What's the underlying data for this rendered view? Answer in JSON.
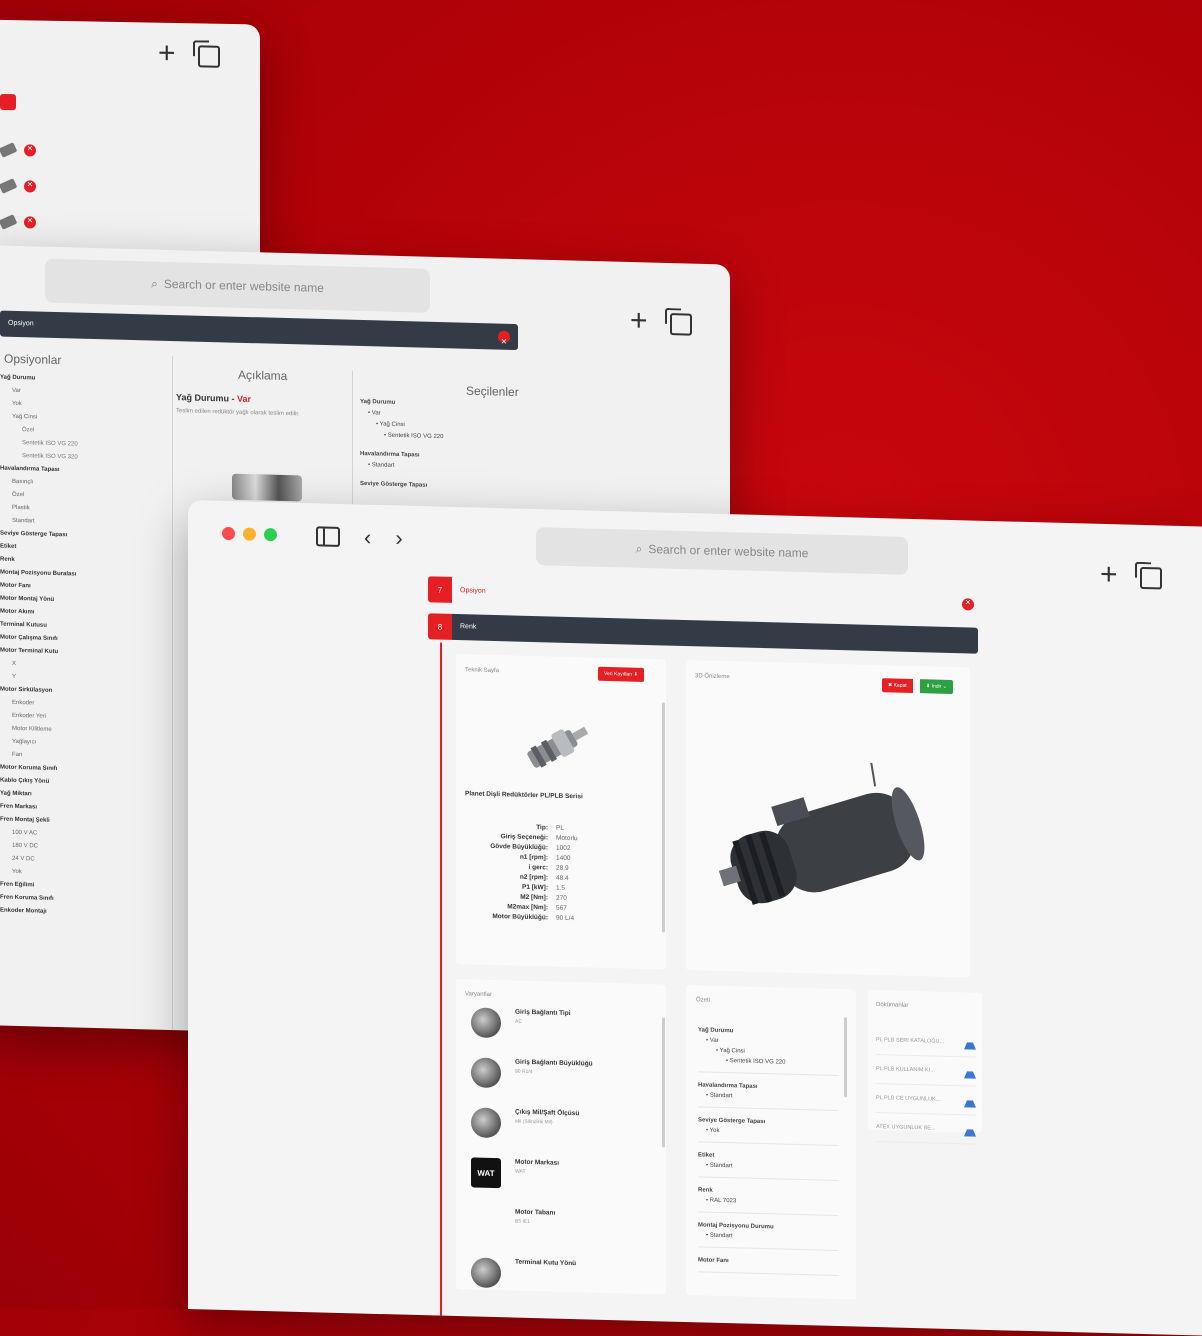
{
  "back_window": {},
  "mid_window": {
    "url_placeholder": "Search or enter website name",
    "bar_label": "Opsiyon",
    "col_options": "Opsiyonlar",
    "col_desc": "Açıklama",
    "col_selected": "Seçilenler",
    "options": [
      {
        "level": 1,
        "text": "Yağ Durumu"
      },
      {
        "level": 2,
        "text": "Var"
      },
      {
        "level": 2,
        "text": "Yok"
      },
      {
        "level": 2,
        "text": "Yağ Cinsi"
      },
      {
        "level": 3,
        "text": "Özel"
      },
      {
        "level": 3,
        "text": "Sentetik ISO VG 220"
      },
      {
        "level": 3,
        "text": "Sentetik ISO VG 320"
      },
      {
        "level": 1,
        "text": "Havalandırma Tapası"
      },
      {
        "level": 2,
        "text": "Basınçlı"
      },
      {
        "level": 2,
        "text": "Özel"
      },
      {
        "level": 2,
        "text": "Plastik"
      },
      {
        "level": 2,
        "text": "Standart"
      },
      {
        "level": 1,
        "text": "Seviye Gösterge Tapası"
      },
      {
        "level": 1,
        "text": "Etiket"
      },
      {
        "level": 1,
        "text": "Renk"
      },
      {
        "level": 1,
        "text": "Montaj Pozisyonu Buralası"
      },
      {
        "level": 1,
        "text": "Motor Fanı"
      },
      {
        "level": 1,
        "text": "Motor Montaj Yönü"
      },
      {
        "level": 1,
        "text": "Motor Akımı"
      },
      {
        "level": 1,
        "text": "Terminal Kutusu"
      },
      {
        "level": 1,
        "text": "Motor Çalışma Sınıfı"
      },
      {
        "level": 1,
        "text": "Motor Terminal Kutu"
      },
      {
        "level": 2,
        "text": "X"
      },
      {
        "level": 2,
        "text": "Y"
      },
      {
        "level": 1,
        "text": "Motor Sirkülasyon"
      },
      {
        "level": 2,
        "text": "Enkoder"
      },
      {
        "level": 2,
        "text": "Enkoder Yeri"
      },
      {
        "level": 2,
        "text": "Motor Kilitleme"
      },
      {
        "level": 2,
        "text": "Yağlayıcı"
      },
      {
        "level": 2,
        "text": "Fan"
      },
      {
        "level": 1,
        "text": "Motor Koruma Sınıfı"
      },
      {
        "level": 1,
        "text": "Kablo Çıkış Yönü"
      },
      {
        "level": 1,
        "text": "Yağ Miktarı"
      },
      {
        "level": 1,
        "text": "Fren Markası"
      },
      {
        "level": 1,
        "text": "Fren Montaj Şekli"
      },
      {
        "level": 2,
        "text": "100 V AC"
      },
      {
        "level": 2,
        "text": "180 V DC"
      },
      {
        "level": 2,
        "text": "24 V DC"
      },
      {
        "level": 2,
        "text": "Yok"
      },
      {
        "level": 1,
        "text": "Fren Eğilimi"
      },
      {
        "level": 1,
        "text": "Fren Koruma Sınıfı"
      },
      {
        "level": 1,
        "text": "Enkoder Montajı"
      }
    ],
    "desc_title": "Yağ Durumu - ",
    "desc_title_accent": "Var",
    "desc_text": "Teslim edilen redüktör yağlı olarak teslim edilir.",
    "selected": [
      {
        "level": 1,
        "text": "Yağ Durumu"
      },
      {
        "level": 2,
        "text": "• Var"
      },
      {
        "level": 3,
        "text": "• Yağ Cinsi"
      },
      {
        "level": 4,
        "text": "• Sentetik ISO VG 220"
      },
      {
        "level": 1,
        "text": "Havalandırma Tapası"
      },
      {
        "level": 2,
        "text": "• Standart"
      },
      {
        "level": 1,
        "text": "Seviye Gösterge Tapası"
      }
    ]
  },
  "front_window": {
    "url_placeholder": "Search or enter website name",
    "step7_num": "7",
    "step7_label": "Opsiyon",
    "step8_num": "8",
    "step8_label": "Renk",
    "tech_title": "Teknik Sayfa",
    "tech_btn": "Veri Kayıtları ⬇",
    "view_title": "3D Önizleme",
    "btn_close": "✖ Kapat",
    "btn_download": "⬇ İndir ⌄",
    "product_name": "Planet Dişli Redüktörler PL/PLB Serisi",
    "specs": [
      {
        "k": "Tip:",
        "v": "PL"
      },
      {
        "k": "Giriş Seçeneği:",
        "v": "Motorlu"
      },
      {
        "k": "Gövde Büyüklüğü:",
        "v": "1002"
      },
      {
        "k": "n1 [rpm]:",
        "v": "1400"
      },
      {
        "k": "i gerc:",
        "v": "28.9"
      },
      {
        "k": "n2 [rpm]:",
        "v": "48.4"
      },
      {
        "k": "P1 [kW]:",
        "v": "1.5"
      },
      {
        "k": "M2 [Nm]:",
        "v": "270"
      },
      {
        "k": "M2max [Nm]:",
        "v": "567"
      },
      {
        "k": "Motor Büyüklüğü:",
        "v": "90 L/4"
      }
    ],
    "parts_title": "Varyantlar",
    "parts": [
      {
        "title": "Giriş Bağlantı Tipi",
        "sub": "AC"
      },
      {
        "title": "Giriş Bağlantı Büyüklüğü",
        "sub": "90 R1/4"
      },
      {
        "title": "Çıkış Mil/Şaft Ölçüsü",
        "sub": "Mil (Silindirik Mil)"
      },
      {
        "title": "Motor Markası",
        "sub": "WAT",
        "logo": "WAT"
      },
      {
        "title": "Motor Tabanı",
        "sub": "B5 IE1"
      },
      {
        "title": "Terminal Kutu Yönü",
        "sub": ""
      }
    ],
    "summary_title": "Özeti",
    "summary": [
      [
        {
          "level": 1,
          "text": "Yağ Durumu"
        },
        {
          "level": 2,
          "text": "• Var"
        },
        {
          "level": 3,
          "text": "• Yağ Cinsi"
        },
        {
          "level": 4,
          "text": "• Sentetik ISO VG 220"
        }
      ],
      [
        {
          "level": 1,
          "text": "Havalandırma Tapası"
        },
        {
          "level": 2,
          "text": "• Standart"
        }
      ],
      [
        {
          "level": 1,
          "text": "Seviye Gösterge Tapası"
        },
        {
          "level": 2,
          "text": "• Yok"
        }
      ],
      [
        {
          "level": 1,
          "text": "Etiket"
        },
        {
          "level": 2,
          "text": "• Standart"
        }
      ],
      [
        {
          "level": 1,
          "text": "Renk"
        },
        {
          "level": 2,
          "text": "• RAL 7023"
        }
      ],
      [
        {
          "level": 1,
          "text": "Montaj Pozisyonu Durumu"
        },
        {
          "level": 2,
          "text": "• Standart"
        }
      ],
      [
        {
          "level": 1,
          "text": "Motor Fanı"
        }
      ]
    ],
    "downloads_title": "Dökümanlar",
    "downloads": [
      "PL PLB SERİ KATALOĞU...",
      "PL PLB KULLANIM KI...",
      "PL PLB CE UYGUNLUK...",
      "ATEX UYGUNLUK BE..."
    ]
  },
  "colors": {
    "brand_red": "#e52025",
    "dark_bar": "#333b46",
    "download_blue": "#3a78d6",
    "success_green": "#2ea043",
    "background": "#b00208"
  }
}
